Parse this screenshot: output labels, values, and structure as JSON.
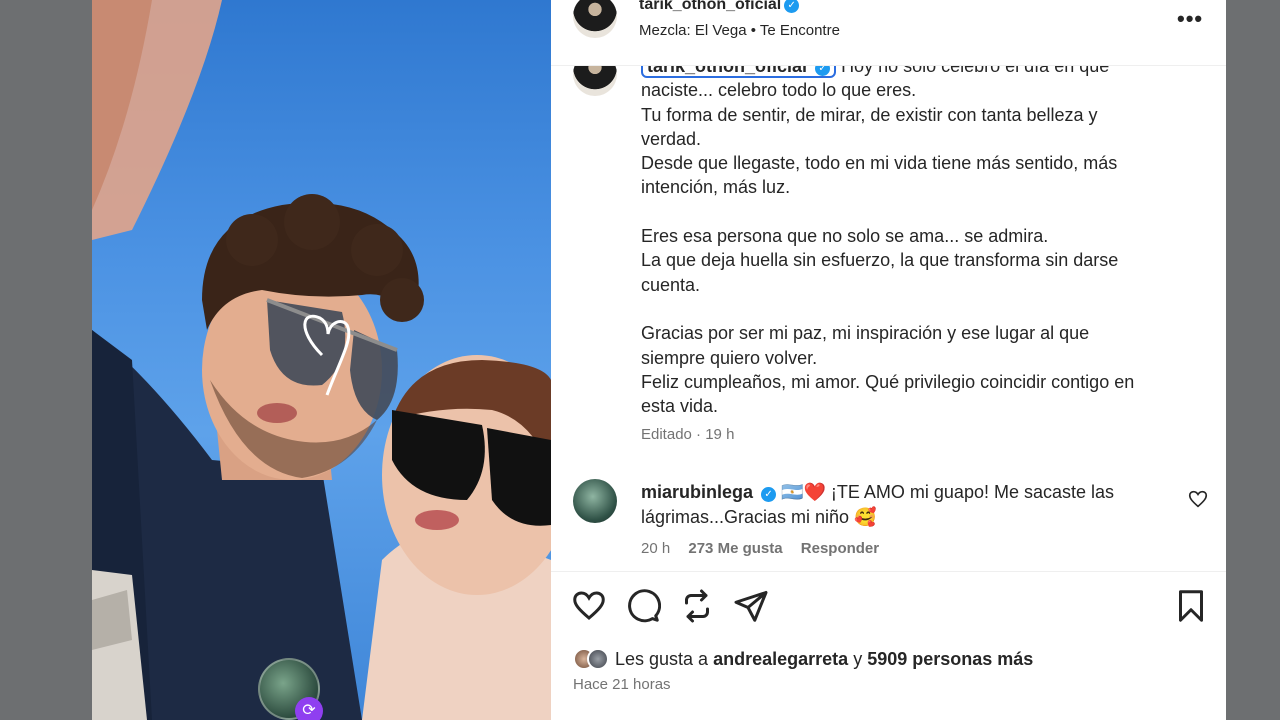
{
  "post": {
    "username": "tarik_othon_oficial",
    "audio": "Mezcla: El Vega • Te Encontre"
  },
  "caption": {
    "username": "tarik_othon_oficial",
    "text": "Hoy no solo celebro el día en que\nnaciste... celebro todo lo que eres.\nTu forma de sentir, de mirar, de existir con tanta belleza y\nverdad.\nDesde que llegaste, todo en mi vida tiene más sentido, más\nintención, más luz.\n\nEres esa persona que no solo se ama... se admira.\nLa que deja huella sin esfuerzo, la que transforma sin darse\ncuenta.\n\nGracias por ser mi paz, mi inspiración y ese lugar al que\nsiempre quiero volver.\nFeliz cumpleaños, mi amor. Qué privilegio coincidir contigo en\nesta vida.",
    "edited": "Editado",
    "time": "19 h"
  },
  "comment": {
    "username": "miarubinlega",
    "emojis": "🇦🇷❤️",
    "text": "¡TE AMO mi guapo! Me sacaste las lágrimas...Gracias mi niño 🥰",
    "time": "20 h",
    "likes": "273 Me gusta",
    "reply": "Responder"
  },
  "likes": {
    "prefix": "Les gusta a",
    "user": "andrealegarreta",
    "joiner": "y",
    "others": "5909 personas más"
  },
  "timestamp": "Hace 21 horas",
  "icons": [
    "heart-icon",
    "comment-icon",
    "repost-icon",
    "share-icon",
    "bookmark-icon",
    "more-icon",
    "verified-icon"
  ]
}
